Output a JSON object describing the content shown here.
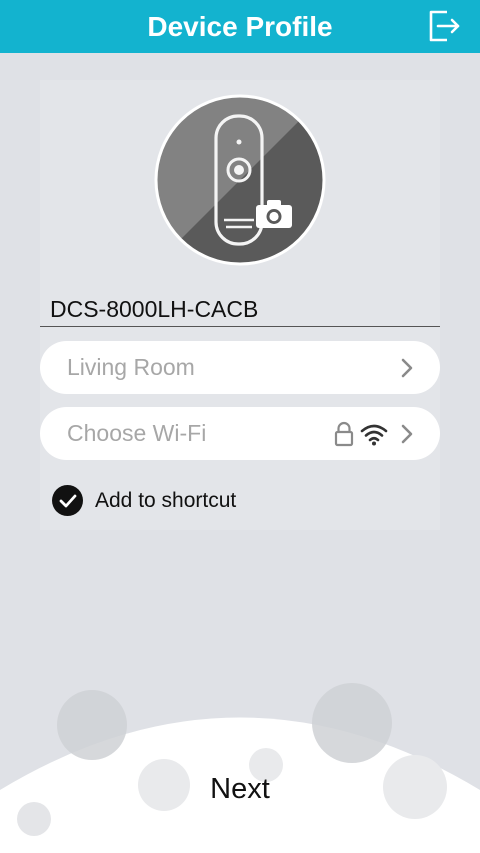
{
  "header": {
    "title": "Device Profile",
    "exit_icon": "exit-icon"
  },
  "device": {
    "name": "DCS-8000LH-CACB",
    "avatar_icon": "camera-device-icon",
    "photo_icon": "camera-icon"
  },
  "location": {
    "placeholder": "Living Room",
    "icon": "chevron-right-icon"
  },
  "wifi": {
    "placeholder": "Choose Wi-Fi",
    "icons": [
      "lock-icon",
      "wifi-icon",
      "chevron-right-icon"
    ]
  },
  "shortcut": {
    "label": "Add to shortcut",
    "checked": true
  },
  "footer": {
    "next_label": "Next"
  },
  "colors": {
    "header": "#13b3cf",
    "background": "#dfe1e6",
    "field": "#ffffff",
    "placeholder": "#a7a7a7"
  }
}
